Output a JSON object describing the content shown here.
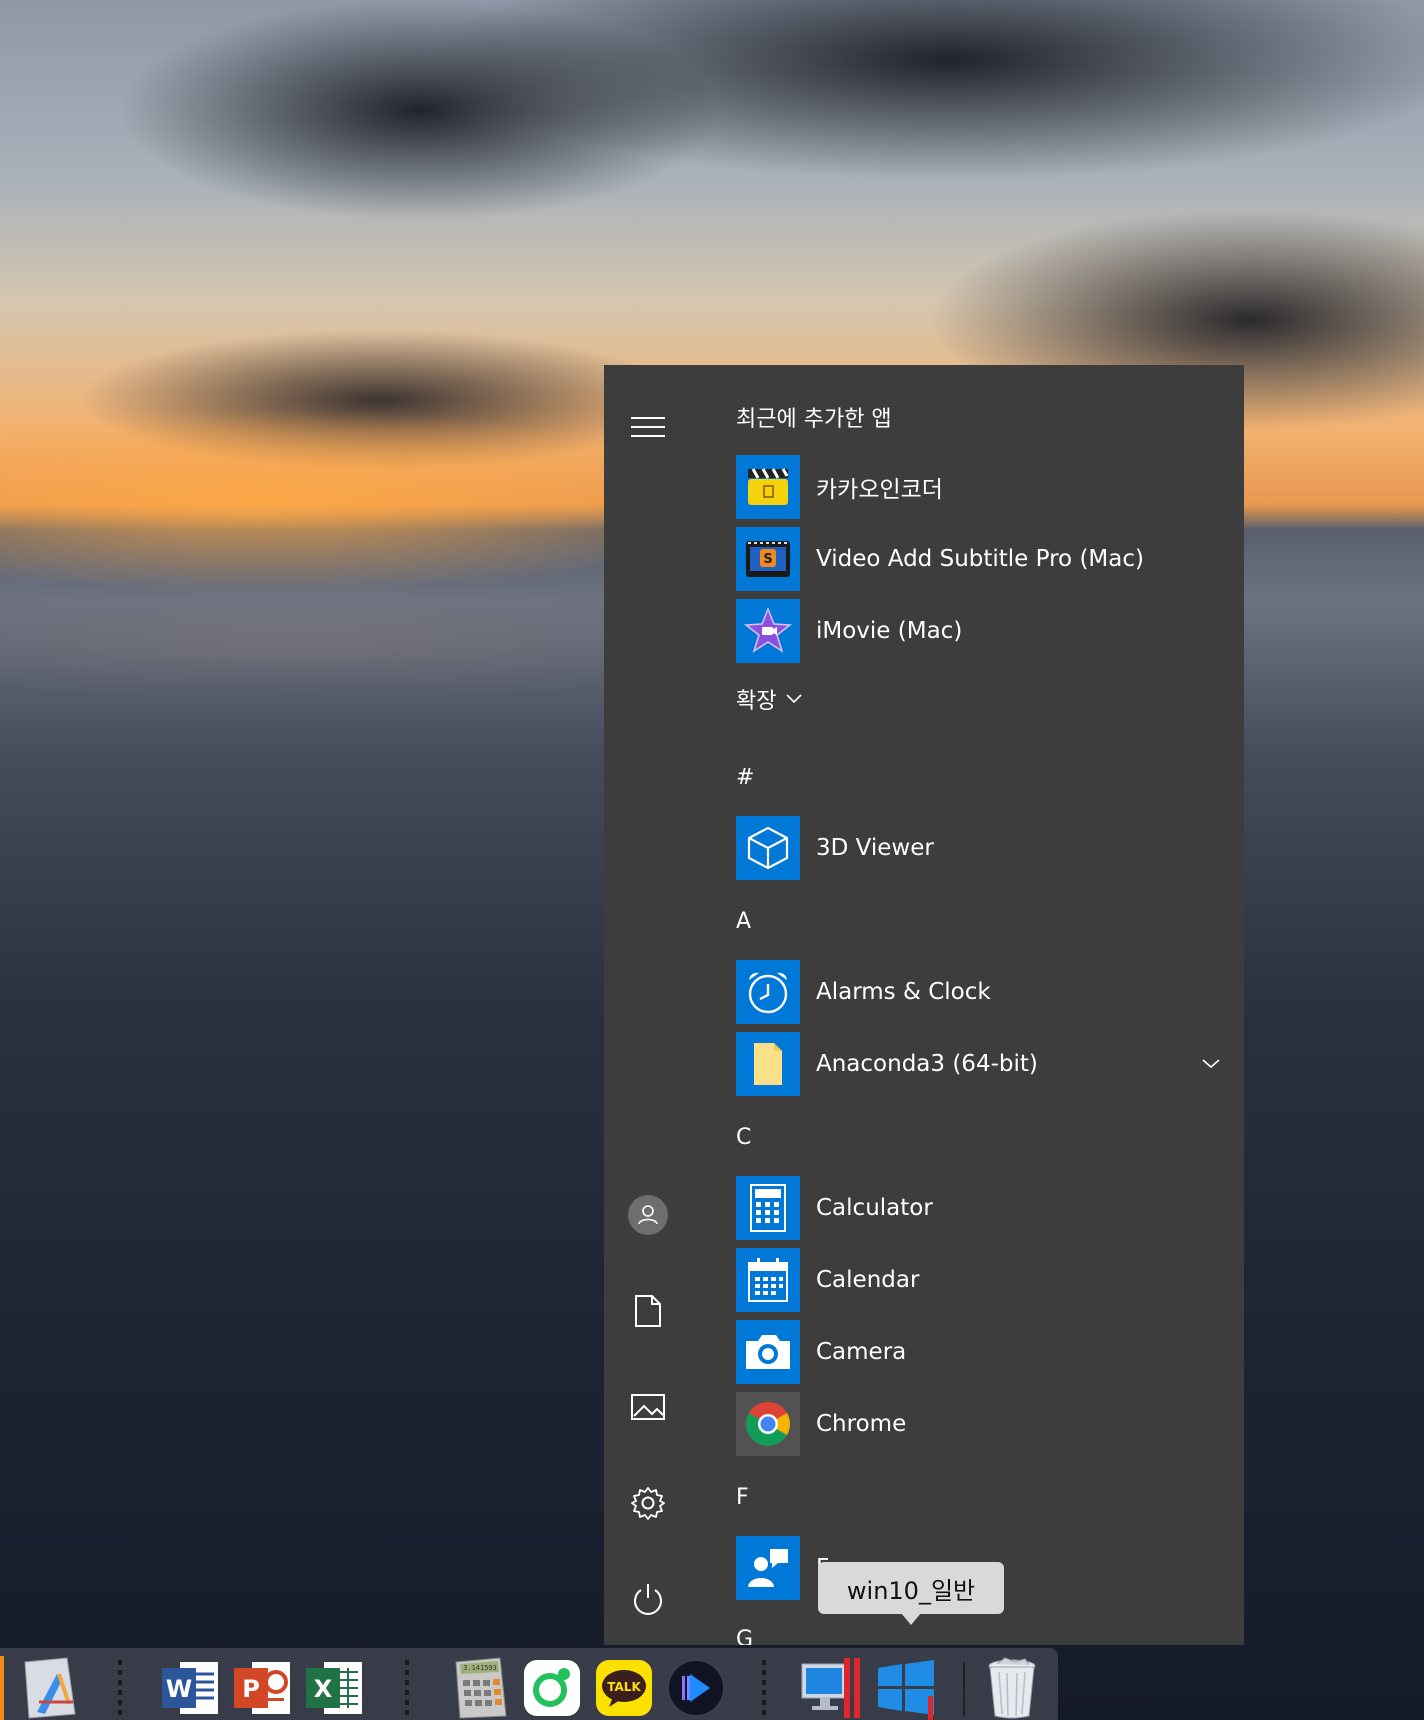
{
  "start_menu": {
    "recently_added_header": "최근에 추가한 앱",
    "recent_apps": [
      {
        "label": "카카오인코더",
        "icon": "clapperboard-icon"
      },
      {
        "label": "Video Add Subtitle Pro (Mac)",
        "icon": "subtitle-film-icon"
      },
      {
        "label": "iMovie (Mac)",
        "icon": "imovie-star-icon"
      }
    ],
    "expand_label": "확장",
    "sections": [
      {
        "letter": "#",
        "apps": [
          {
            "label": "3D Viewer",
            "icon": "cube-icon"
          }
        ]
      },
      {
        "letter": "A",
        "apps": [
          {
            "label": "Alarms & Clock",
            "icon": "alarm-clock-icon"
          },
          {
            "label": "Anaconda3 (64-bit)",
            "icon": "folder-icon",
            "expandable": true
          }
        ]
      },
      {
        "letter": "C",
        "apps": [
          {
            "label": "Calculator",
            "icon": "calculator-icon"
          },
          {
            "label": "Calendar",
            "icon": "calendar-icon"
          },
          {
            "label": "Camera",
            "icon": "camera-icon"
          },
          {
            "label": "Chrome",
            "icon": "chrome-icon"
          }
        ]
      },
      {
        "letter": "F",
        "apps": [
          {
            "label": "F",
            "icon": "feedback-hub-icon"
          }
        ]
      },
      {
        "letter": "G",
        "apps": []
      }
    ],
    "rail": [
      "menu-icon",
      "user-icon",
      "document-icon",
      "pictures-icon",
      "settings-icon",
      "power-icon"
    ]
  },
  "tooltip": {
    "text": "win10_일반"
  },
  "dock": {
    "items": [
      "Xcode",
      "Word",
      "PowerPoint",
      "Excel",
      "Calculator",
      "Naver Line",
      "KakaoTalk",
      "Player",
      "Parallels",
      "Windows 10",
      "Trash"
    ],
    "kakaotalk_badge": "TALK",
    "calc_display": "3.141593"
  },
  "colors": {
    "start_bg": "#3d3d3d",
    "tile_blue": "#0078d7",
    "tooltip_bg": "#d9d9d9"
  }
}
